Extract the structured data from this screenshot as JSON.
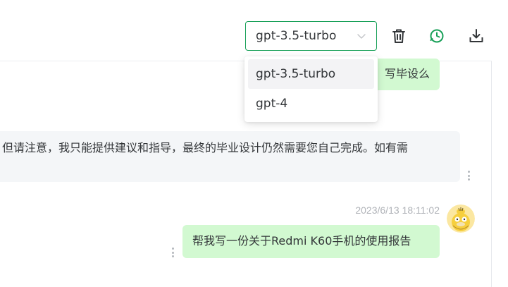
{
  "header": {
    "model_select": {
      "value": "gpt-3.5-turbo"
    },
    "tools": [
      {
        "name": "delete-icon"
      },
      {
        "name": "history-icon",
        "color": "#18a058"
      },
      {
        "name": "download-icon"
      }
    ]
  },
  "dropdown": {
    "options": [
      {
        "label": "gpt-3.5-turbo",
        "selected": true
      },
      {
        "label": "gpt-4",
        "selected": false
      }
    ]
  },
  "messages": [
    {
      "role": "user",
      "text": "写毕设么",
      "truncated": true
    },
    {
      "role": "assistant",
      "text": "但请注意，我只能提供建议和指导，最终的毕业设计仍然需要您自己完成。如有需",
      "truncated": true
    },
    {
      "role": "user",
      "timestamp": "2023/6/13 18:11:02",
      "text": "帮我写一份关于Redmi K60手机的使用报告"
    }
  ],
  "colors": {
    "accent": "#18a058",
    "user_bubble": "#d2f9d1",
    "bot_bubble": "#f4f6f8",
    "timestamp": "#b0b3b8"
  }
}
